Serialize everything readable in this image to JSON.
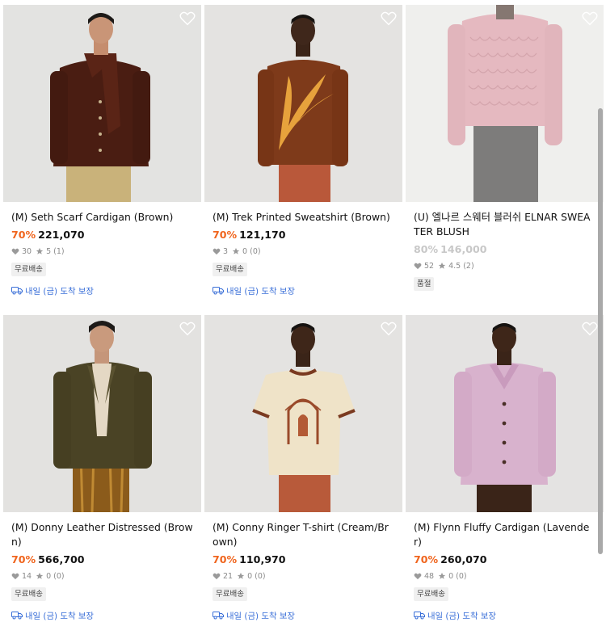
{
  "products": [
    {
      "title": "(M) Seth Scarf Cardigan (Brown)",
      "discount": "70%",
      "price": "221,070",
      "likes": "30",
      "rating": "5 (1)",
      "badge": "무료배송",
      "delivery": "내일 (금) 도착 보장",
      "sold_out": false,
      "image": "model-brown-scarf-cardigan"
    },
    {
      "title": "(M) Trek Printed Sweatshirt (Brown)",
      "discount": "70%",
      "price": "121,170",
      "likes": "3",
      "rating": "0 (0)",
      "badge": "무료배송",
      "delivery": "내일 (금) 도착 보장",
      "sold_out": false,
      "image": "model-brown-printed-sweatshirt"
    },
    {
      "title": "(U) 엘나르 스웨터 블러쉬 ELNAR SWEATER BLUSH",
      "discount": "80%",
      "price": "146,000",
      "likes": "52",
      "rating": "4.5 (2)",
      "badge": "품절",
      "delivery": "",
      "sold_out": true,
      "image": "model-pink-knit-sweater"
    },
    {
      "title": "(M) Donny Leather Distressed (Brown)",
      "discount": "70%",
      "price": "566,700",
      "likes": "14",
      "rating": "0 (0)",
      "badge": "무료배송",
      "delivery": "내일 (금) 도착 보장",
      "sold_out": false,
      "image": "model-leather-jacket"
    },
    {
      "title": "(M) Conny Ringer T-shirt (Cream/Brown)",
      "discount": "70%",
      "price": "110,970",
      "likes": "21",
      "rating": "0 (0)",
      "badge": "무료배송",
      "delivery": "내일 (금) 도착 보장",
      "sold_out": false,
      "image": "model-ringer-tshirt"
    },
    {
      "title": "(M) Flynn Fluffy Cardigan (Lavender)",
      "discount": "70%",
      "price": "260,070",
      "likes": "48",
      "rating": "0 (0)",
      "badge": "무료배송",
      "delivery": "내일 (금) 도착 보장",
      "sold_out": false,
      "image": "model-lavender-fluffy-cardigan"
    }
  ],
  "colors": {
    "discount": "#f0651e",
    "delivery": "#3a6fd8",
    "sold_out_text": "#c8c8c8"
  }
}
